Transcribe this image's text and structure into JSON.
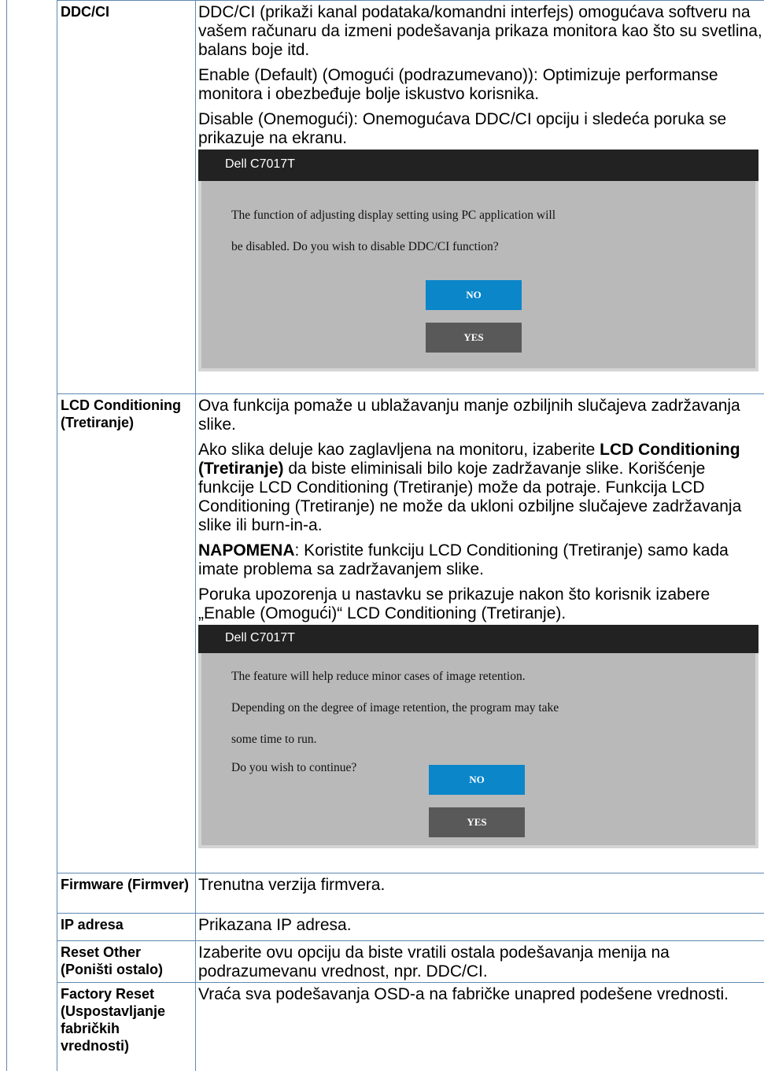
{
  "rows": [
    {
      "name": "DDC/CI",
      "paragraphs": [
        "DDC/CI (prikaži kanal podataka/komandni interfejs) omogućava softveru na vašem računaru da izmeni podešavanja prikaza monitora kao što su svetlina, balans boje itd.",
        "Enable (Default) (Omogući (podrazumevano)): Optimizuje performanse monitora i obezbeđuje bolje iskustvo korisnika.",
        "Disable (Onemogući): Onemogućava DDC/CI opciju i sledeća poruka se prikazuje na ekranu."
      ],
      "dialog": {
        "title": "Dell C7017T",
        "lines": [
          "The function of adjusting display setting using PC application will",
          "be disabled. Do you wish to disable DDC/CI function?"
        ],
        "no_label": "NO",
        "yes_label": "YES"
      }
    },
    {
      "name": "LCD Conditioning (Tretiranje)",
      "p1": "Ova funkcija pomaže u ublažavanju manje ozbiljnih slučajeva zadržavanja slike.",
      "p2_before": "Ako slika deluje kao zaglavljena na monitoru, izaberite ",
      "p2_bold": "LCD Conditioning (Tretiranje)",
      "p2_after": " da biste eliminisali bilo koje zadržavanje slike. Korišćenje funkcije LCD Conditioning (Tretiranje) može da potraje. Funkcija LCD Conditioning (Tretiranje) ne može da ukloni ozbiljne slučajeve zadržavanja slike ili burn-in-a.",
      "note_label": "NAPOMENA",
      "note_text": ": Koristite funkciju LCD Conditioning (Tretiranje) samo kada imate problema sa zadržavanjem slike.",
      "p4": "Poruka upozorenja u nastavku se prikazuje nakon što korisnik izabere „Enable (Omogući)“ LCD Conditioning (Tretiranje).",
      "dialog": {
        "title": "Dell C7017T",
        "lines": [
          "The feature will help reduce minor cases of image retention.",
          "Depending on the degree of image retention, the program may take",
          "some time to run.",
          "Do you wish to continue?"
        ],
        "no_label": "NO",
        "yes_label": "YES"
      }
    },
    {
      "name": "Firmware (Firmver)",
      "desc": "Trenutna verzija firmvera."
    },
    {
      "name": "IP adresa",
      "desc": "Prikazana IP adresa."
    },
    {
      "name": "Reset Other (Poništi ostalo)",
      "desc": "Izaberite ovu opciju da biste vratili ostala podešavanja menija na podrazumevanu vrednost, npr. DDC/CI."
    },
    {
      "name": "Factory Reset (Uspostavljanje fabričkih vrednosti)",
      "desc": "Vraća sva podešavanja OSD-a na fabričke unapred podešene vrednosti."
    }
  ]
}
